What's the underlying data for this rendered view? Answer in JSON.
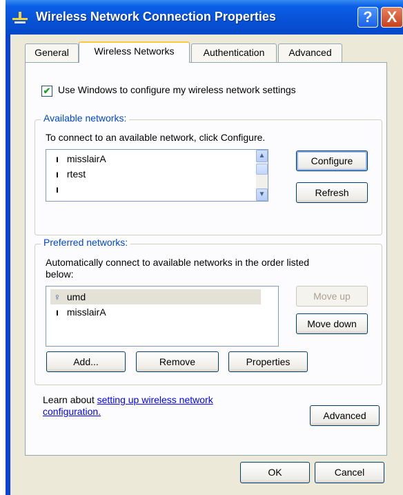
{
  "window": {
    "title": "Wireless Network Connection Properties",
    "title_icon": "network-connection-icon",
    "help_label": "?",
    "close_label": "X"
  },
  "tabs": [
    {
      "label": "General",
      "active": false
    },
    {
      "label": "Wireless Networks",
      "active": true
    },
    {
      "label": "Authentication",
      "active": false
    },
    {
      "label": "Advanced",
      "active": false
    }
  ],
  "use_windows": {
    "checked": true,
    "label": "Use Windows to configure my wireless network settings"
  },
  "available": {
    "title": "Available networks:",
    "instruction": "To connect to an available network, click Configure.",
    "items": [
      {
        "name": "misslairA",
        "icon": "antenna-icon"
      },
      {
        "name": "rtest",
        "icon": "antenna-icon"
      },
      {
        "name": "",
        "icon": "antenna-icon"
      }
    ],
    "configure_label": "Configure",
    "refresh_label": "Refresh"
  },
  "preferred": {
    "title": "Preferred networks:",
    "instruction_line1": "Automatically connect to available networks in the order listed",
    "instruction_line2": "below:",
    "items": [
      {
        "name": "umd",
        "icon": "connected-antenna-icon",
        "selected": true
      },
      {
        "name": "misslairA",
        "icon": "antenna-icon",
        "selected": false
      }
    ],
    "move_up_label": "Move up",
    "move_down_label": "Move down",
    "add_label": "Add...",
    "remove_label": "Remove",
    "properties_label": "Properties"
  },
  "learn": {
    "prefix": "Learn about ",
    "link_line1": "setting up wireless network",
    "link_line2": "configuration.",
    "advanced_label": "Advanced"
  },
  "footer": {
    "ok_label": "OK",
    "cancel_label": "Cancel"
  }
}
